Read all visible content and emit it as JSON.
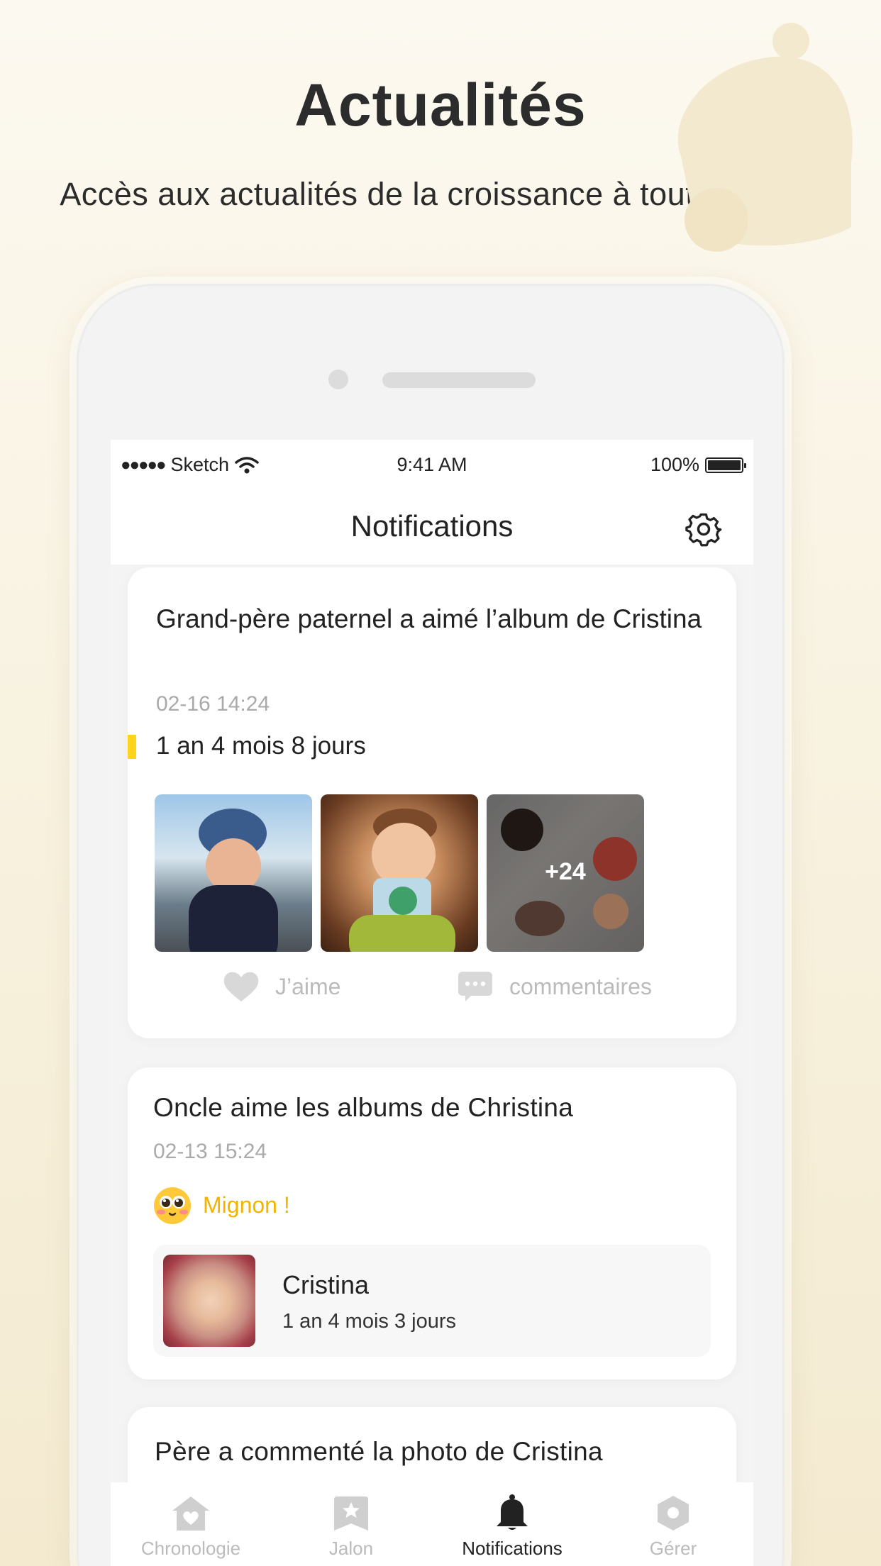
{
  "hero": {
    "title": "Actualités",
    "subtitle": "Accès aux actualités de la croissance à tout moment"
  },
  "status_bar": {
    "signal": "●●●●●",
    "carrier": "Sketch",
    "time": "9:41 AM",
    "battery": "100%"
  },
  "nav": {
    "title": "Notifications",
    "settings_icon": "gear-icon"
  },
  "card1": {
    "title": "Grand-père paternel a aimé l’album de Cristina",
    "date": "02-16 14:24",
    "age": "1 an 4 mois 8 jours",
    "more_photos": "+24",
    "like_label": "J’aime",
    "comment_label": "commentaires"
  },
  "card2": {
    "title": "Oncle aime les albums de Christina",
    "date": "02-13 15:24",
    "reaction": "Mignon !",
    "album_name": "Cristina",
    "album_age": "1 an 4 mois 3 jours"
  },
  "card3": {
    "title": "Père a commenté la photo de Cristina"
  },
  "tabs": [
    {
      "label": "Chronologie",
      "icon": "home-heart-icon",
      "active": false
    },
    {
      "label": "Jalon",
      "icon": "bookmark-star-icon",
      "active": false
    },
    {
      "label": "Notifications",
      "icon": "bell-icon",
      "active": true
    },
    {
      "label": "Gérer",
      "icon": "hexagon-icon",
      "active": false
    }
  ],
  "colors": {
    "accent": "#ffd51c",
    "reaction": "#f2b400",
    "background": "#f7f0dc"
  }
}
